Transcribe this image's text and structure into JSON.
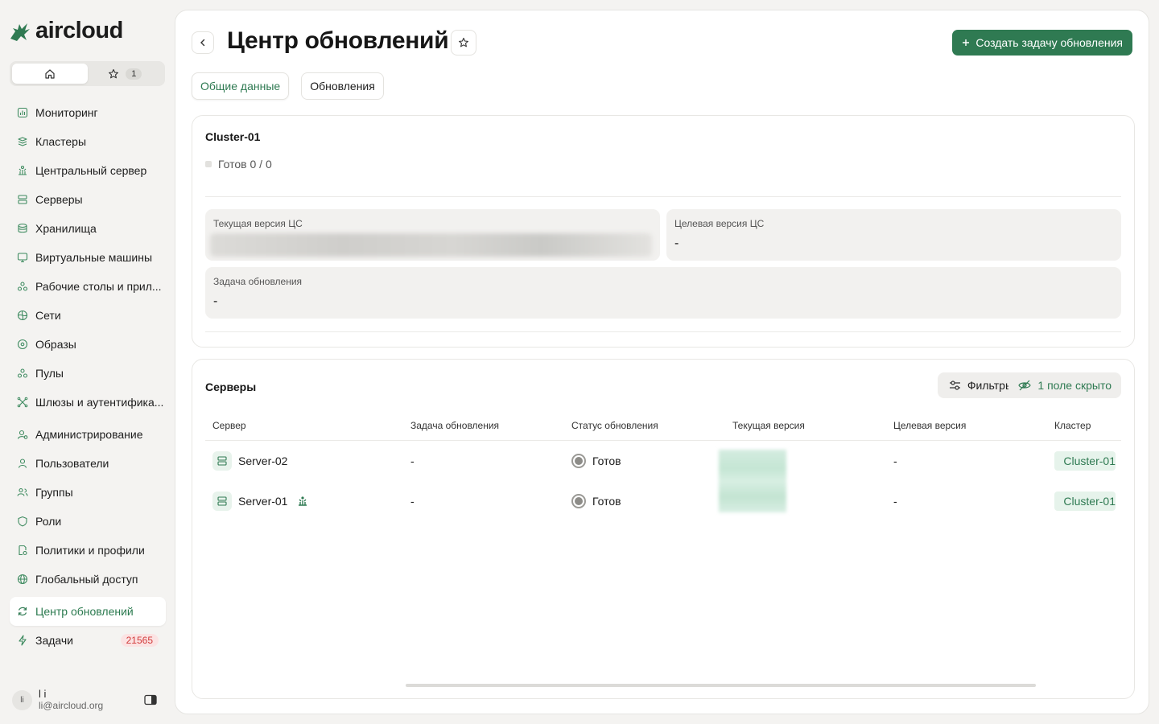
{
  "app": {
    "logo_text": "aircloud"
  },
  "switcher": {
    "favorites_count": "1"
  },
  "nav": [
    {
      "label": "Мониторинг",
      "icon": "monitoring-icon"
    },
    {
      "label": "Кластеры",
      "icon": "clusters-icon"
    },
    {
      "label": "Центральный сервер",
      "icon": "central-server-icon"
    },
    {
      "label": "Серверы",
      "icon": "servers-icon"
    },
    {
      "label": "Хранилища",
      "icon": "storage-icon"
    },
    {
      "label": "Виртуальные машины",
      "icon": "vm-icon"
    },
    {
      "label": "Рабочие столы и прил...",
      "icon": "desktops-icon"
    },
    {
      "label": "Сети",
      "icon": "networks-icon"
    },
    {
      "label": "Образы",
      "icon": "images-icon"
    },
    {
      "label": "Пулы",
      "icon": "pools-icon"
    },
    {
      "label": "Шлюзы и аутентифика...",
      "icon": "gateways-icon"
    },
    {
      "label": "Администрирование",
      "icon": "admin-icon"
    },
    {
      "label": "Пользователи",
      "icon": "users-icon"
    },
    {
      "label": "Группы",
      "icon": "groups-icon"
    },
    {
      "label": "Роли",
      "icon": "roles-icon"
    },
    {
      "label": "Политики и профили",
      "icon": "policies-icon"
    },
    {
      "label": "Глобальный доступ",
      "icon": "global-access-icon"
    },
    {
      "label": "Центр обновлений",
      "icon": "update-center-icon",
      "active": true
    },
    {
      "label": "Задачи",
      "icon": "tasks-icon",
      "badge": "21565"
    }
  ],
  "user": {
    "name": "l i",
    "email": "li@aircloud.org",
    "initials": "li"
  },
  "page": {
    "title": "Центр обновлений",
    "create_button": "Создать задачу обновления",
    "tabs": [
      "Общие данные",
      "Обновления"
    ]
  },
  "cluster": {
    "name": "Cluster-01",
    "ready": "Готов 0 / 0",
    "current_cs_version_label": "Текущая версия ЦС",
    "target_cs_version_label": "Целевая версия ЦС",
    "target_cs_version_value": "-",
    "update_task_label": "Задача обновления",
    "update_task_value": "-"
  },
  "servers": {
    "title": "Серверы",
    "filters_button": "Фильтры",
    "hidden_fields_button": "1 поле скрыто",
    "columns": [
      "Сервер",
      "Задача обновления",
      "Статус обновления",
      "Текущая версия",
      "Целевая версия",
      "Кластер"
    ],
    "rows": [
      {
        "server": "Server-02",
        "task": "-",
        "status": "Готов",
        "target": "-",
        "cluster": "Cluster-01",
        "central": false
      },
      {
        "server": "Server-01",
        "task": "-",
        "status": "Готов",
        "target": "-",
        "cluster": "Cluster-01",
        "central": true
      }
    ]
  },
  "colors": {
    "accent": "#2f7a52",
    "badge_red": "#d23b3b",
    "background": "#f4f3f1"
  }
}
